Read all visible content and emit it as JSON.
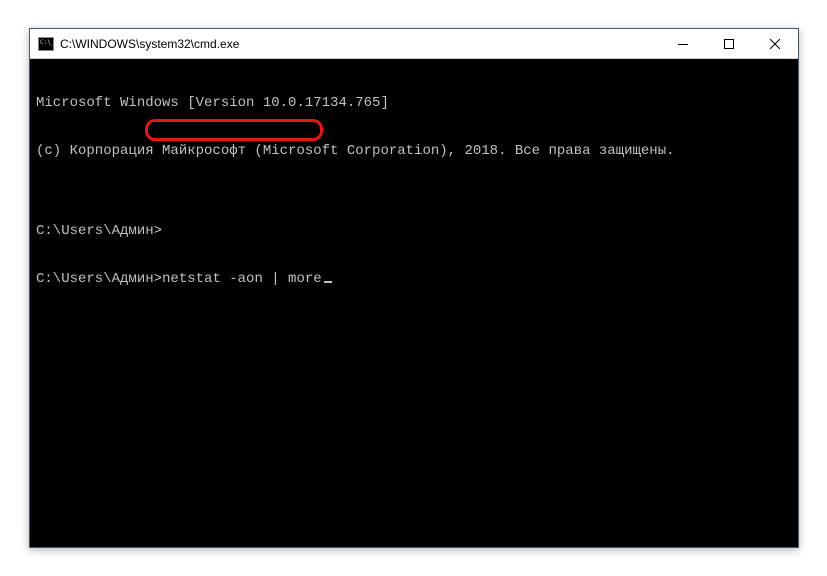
{
  "window": {
    "title": "C:\\WINDOWS\\system32\\cmd.exe"
  },
  "console": {
    "line1": "Microsoft Windows [Version 10.0.17134.765]",
    "line2": "(c) Корпорация Майкрософт (Microsoft Corporation), 2018. Все права защищены.",
    "blank": "",
    "prompt1": "C:\\Users\\Админ>",
    "prompt2": "C:\\Users\\Админ>",
    "command": "netstat -aon | more"
  },
  "icons": {
    "minimize": "minimize",
    "maximize": "maximize",
    "close": "close"
  }
}
